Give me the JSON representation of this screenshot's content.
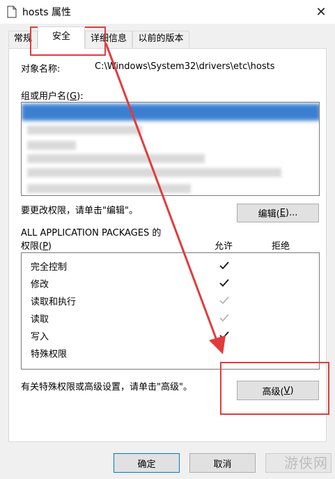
{
  "window": {
    "title": "hosts 属性",
    "close_symbol": "✕"
  },
  "tabs": [
    {
      "label": "常规"
    },
    {
      "label": "安全"
    },
    {
      "label": "详细信息"
    },
    {
      "label": "以前的版本"
    }
  ],
  "security": {
    "object_name_label": "对象名称:",
    "object_name_value": "C:\\Windows\\System32\\drivers\\etc\\hosts",
    "groups_label_prefix": "组或用户名(",
    "groups_label_key": "G",
    "groups_label_suffix": "):",
    "edit_hint": "要更改权限，请单击\"编辑\"。",
    "edit_button": {
      "prefix": "编辑(",
      "key": "E",
      "suffix": ")..."
    },
    "perm_title": "ALL APPLICATION PACKAGES 的",
    "perm_label_prefix": "权限(",
    "perm_label_key": "P",
    "perm_label_suffix": ")",
    "allow_header": "允许",
    "deny_header": "拒绝",
    "permissions": [
      {
        "name": "完全控制",
        "allow": "dark"
      },
      {
        "name": "修改",
        "allow": "dark"
      },
      {
        "name": "读取和执行",
        "allow": "gray"
      },
      {
        "name": "读取",
        "allow": "gray"
      },
      {
        "name": "写入",
        "allow": "dark"
      },
      {
        "name": "特殊权限",
        "allow": "none"
      }
    ],
    "advanced_hint": "有关特殊权限或高级设置，请单击\"高级\"。",
    "advanced_button": {
      "prefix": "高级(",
      "key": "V",
      "suffix": ")"
    }
  },
  "footer": {
    "ok": "确定",
    "cancel": "取消"
  },
  "watermark": "游侠网",
  "colors": {
    "annotation_red": "#e23b3b",
    "selection_blue": "#3b7fd1"
  }
}
